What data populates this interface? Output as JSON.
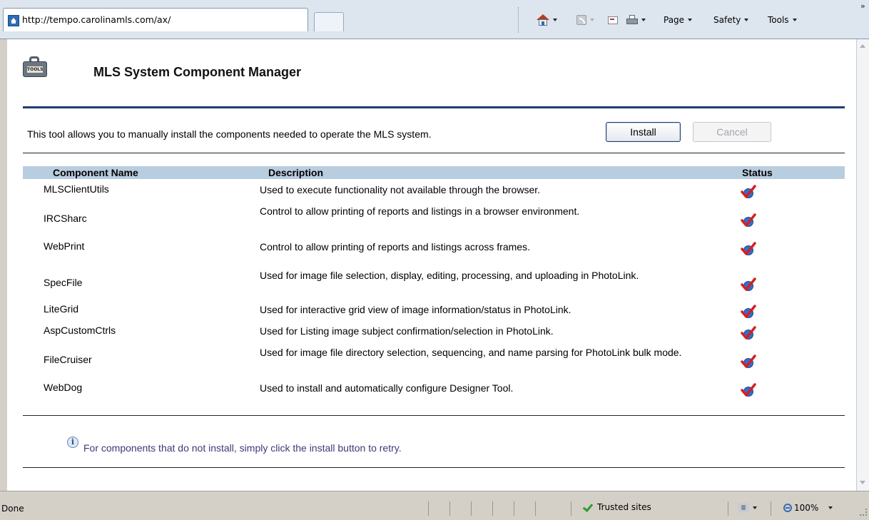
{
  "browser": {
    "tab_url": "http://tempo.carolinamls.com/ax/",
    "commands": {
      "home": "home-icon",
      "feeds": "feed-icon",
      "mail": "mail-icon",
      "print": "print-icon",
      "page_label": "Page",
      "safety_label": "Safety",
      "tools_label": "Tools"
    }
  },
  "page": {
    "title": "MLS System Component Manager",
    "tools_tag": "TOOLS",
    "intro": "This tool allows you to manually install the components needed to operate the MLS system.",
    "install_label": "Install",
    "cancel_label": "Cancel",
    "columns": {
      "name": "Component Name",
      "description": "Description",
      "status": "Status"
    },
    "components": [
      {
        "name": "MLSClientUtils",
        "description": "Used to execute functionality not available through the browser.",
        "status": "installed"
      },
      {
        "name": "IRCSharc",
        "description": "Control to allow printing of reports and listings in a browser environment.",
        "status": "installed"
      },
      {
        "name": "WebPrint",
        "description": "Control to allow printing of reports and listings across frames.",
        "status": "installed"
      },
      {
        "name": "SpecFile",
        "description": "Used for image file selection, display, editing, processing, and uploading in PhotoLink.",
        "status": "installed"
      },
      {
        "name": "LiteGrid",
        "description": "Used for interactive grid view of image information/status in PhotoLink.",
        "status": "installed"
      },
      {
        "name": "AspCustomCtrls",
        "description": "Used for Listing image subject confirmation/selection in PhotoLink.",
        "status": "installed"
      },
      {
        "name": "FileCruiser",
        "description": "Used for image file directory selection, sequencing, and name parsing for PhotoLink bulk mode.",
        "status": "installed"
      },
      {
        "name": "WebDog",
        "description": "Used to install and automatically configure Designer Tool.",
        "status": "installed"
      }
    ],
    "tip": "For components that do not install, simply click the install button to retry."
  },
  "statusbar": {
    "text": "Done",
    "zone": "Trusted sites",
    "zoom": "100%"
  },
  "colors": {
    "title_rule": "#1f3c6e",
    "header_band": "#b9cde0",
    "tip_text": "#3b3a78",
    "check_red": "#d42020",
    "status_disc": "#2f6fd0"
  }
}
